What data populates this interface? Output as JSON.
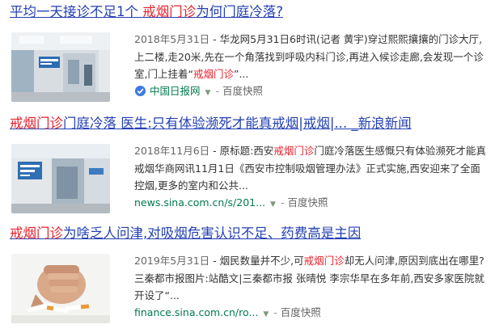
{
  "results": [
    {
      "title_pre": "平均一天接诊不足1个 ",
      "title_hl": "戒烟门诊",
      "title_post": "为何门庭冷落?",
      "date": "2018年5月31日",
      "snippet_pre": " - 华龙网5月31日6时讯(记者 黄宇)穿过熙熙攘攘的门诊大厅,上二楼,走20米,先在一个角落找到呼吸内科门诊,再进入候诊走廊,会发现一个诊室,门上挂着“",
      "snippet_hl": "戒烟门诊",
      "snippet_post": "”...",
      "source": "中国日报网",
      "source_icon": "verified-badge-icon",
      "cache_label": "百度快照",
      "thumb": "hospital-corridor-photo"
    },
    {
      "title_hl": "戒烟门诊",
      "title_post": "门庭冷落 医生:只有体验濒死才能真戒烟|戒烟|... _新浪新闻",
      "date": "2018年11月6日",
      "snippet_pre": " - 原标题:西安",
      "snippet_hl": "戒烟门诊",
      "snippet_post": "门庭冷落医生感慨只有体验濒死才能真戒烟华商网讯11月1日《西安市控制吸烟管理办法》正式实施,西安迎来了全面控烟,更多的室内和公共...",
      "source": "news.sina.com.cn/s/201...",
      "cache_label": "百度快照",
      "thumb": "clinic-hallway-photo"
    },
    {
      "title_hl": "戒烟门诊",
      "title_post": "为啥乏人问津,对吸烟危害认识不足、药费高是主因",
      "date": "2019年5月31日",
      "snippet_pre": " - 烟民数量并不少,可",
      "snippet_hl": "戒烟门诊",
      "snippet_post": "却无人问津,原因到底出在哪里?三秦都市报图片:站酷文|三秦都市报 张晴悦 李宗华早在多年前,西安多家医院就开设了“...",
      "source": "finance.sina.com.cn/ro...",
      "cache_label": "百度快照",
      "thumb": "fist-crushing-cigarettes-photo"
    }
  ]
}
